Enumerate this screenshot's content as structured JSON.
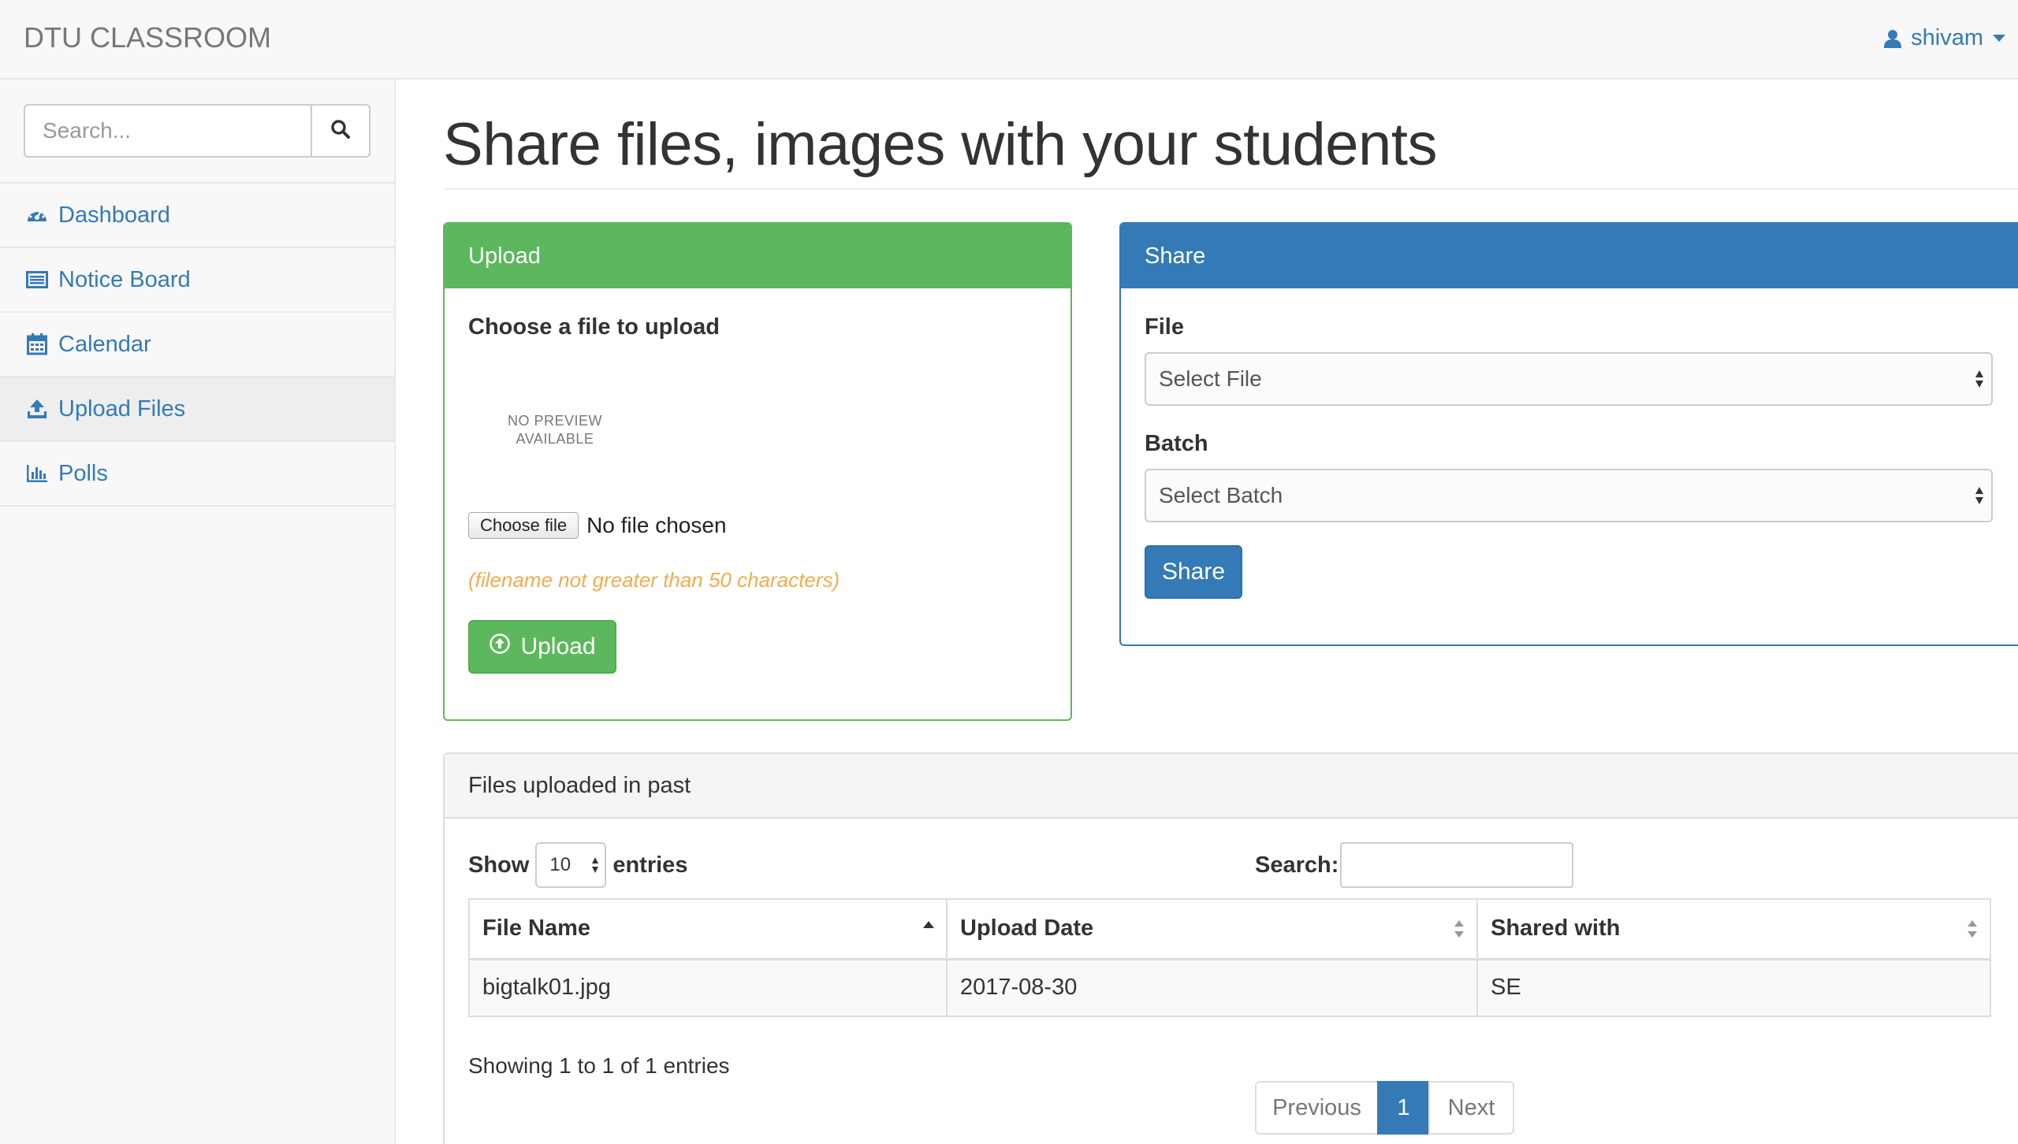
{
  "navbar": {
    "brand": "DTU CLASSROOM",
    "username": "shivam"
  },
  "sidebar": {
    "search_placeholder": "Search...",
    "items": [
      {
        "label": "Dashboard",
        "icon": "dashboard-icon"
      },
      {
        "label": "Notice Board",
        "icon": "notice-board-icon"
      },
      {
        "label": "Calendar",
        "icon": "calendar-icon"
      },
      {
        "label": "Upload Files",
        "icon": "upload-icon",
        "active": true
      },
      {
        "label": "Polls",
        "icon": "bar-chart-icon"
      }
    ]
  },
  "page": {
    "title": "Share files, images with your students"
  },
  "upload_panel": {
    "heading": "Upload",
    "choose_label": "Choose a file to upload",
    "no_preview_line1": "NO PREVIEW",
    "no_preview_line2": "AVAILABLE",
    "choose_button": "Choose file",
    "no_file_text": "No file chosen",
    "hint": "(filename not greater than 50 characters)",
    "upload_button": "Upload"
  },
  "share_panel": {
    "heading": "Share",
    "file_label": "File",
    "file_select": "Select File",
    "batch_label": "Batch",
    "batch_select": "Select Batch",
    "share_button": "Share"
  },
  "files_panel": {
    "heading": "Files uploaded in past",
    "show_label": "Show",
    "page_length": "10",
    "entries_label": "entries",
    "search_label": "Search:",
    "columns": [
      "File Name",
      "Upload Date",
      "Shared with"
    ],
    "rows": [
      [
        "bigtalk01.jpg",
        "2017-08-30",
        "SE"
      ]
    ],
    "info": "Showing 1 to 1 of 1 entries",
    "pagination": {
      "previous": "Previous",
      "current": "1",
      "next": "Next"
    }
  },
  "colors": {
    "success": "#5cb85c",
    "primary": "#337ab7",
    "warning": "#f0ad4e"
  }
}
